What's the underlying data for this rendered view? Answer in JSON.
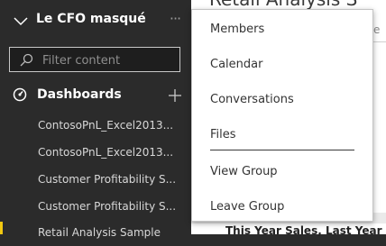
{
  "workspace": {
    "title": "Le CFO masqué"
  },
  "search": {
    "placeholder": "Filter content"
  },
  "dashboards": {
    "label": "Dashboards",
    "items": [
      "ContosoPnL_Excel2013...",
      "ContosoPnL_Excel2013...",
      "Customer Profitability S...",
      "Customer Profitability S...",
      "Retail Analysis Sample"
    ]
  },
  "background": {
    "report_title": "Retail Analysis S",
    "edge_text": "e",
    "visual_title": "This Year Sales, Last Year Sal"
  },
  "menu": {
    "items": [
      "Members",
      "Calendar",
      "Conversations",
      "Files",
      "View Group",
      "Leave Group"
    ]
  },
  "colors": {
    "nav_bg": "#2b2b2b",
    "accent": "#f2c811",
    "menu_bg": "#ffffff"
  }
}
